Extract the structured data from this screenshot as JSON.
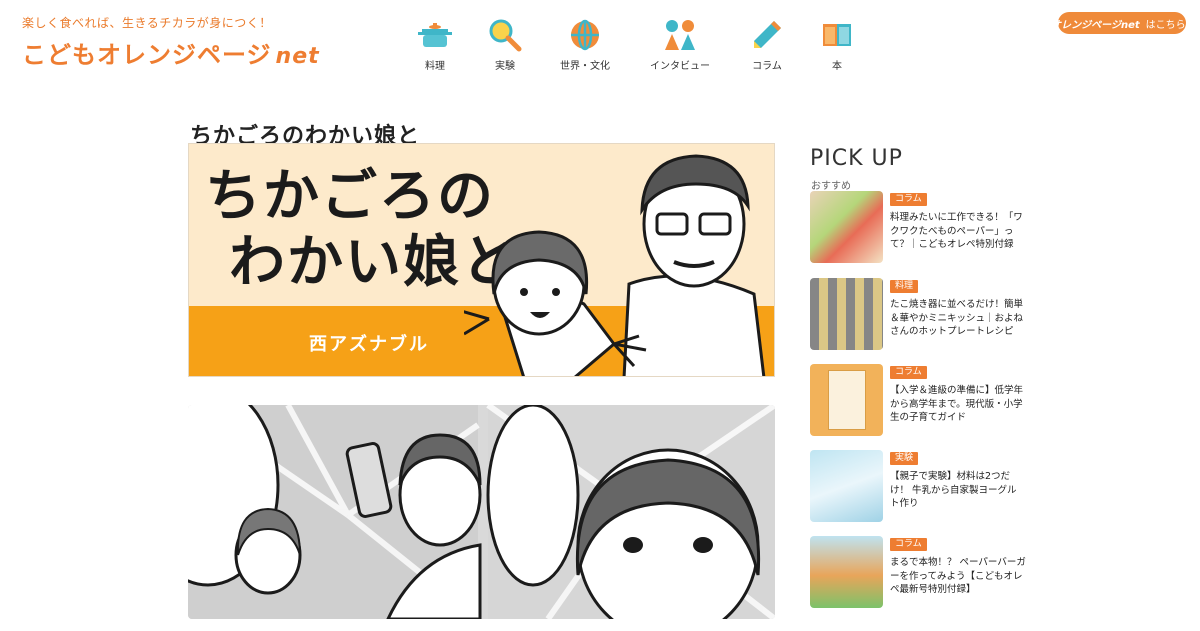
{
  "header": {
    "tagline": "楽しく食べれば、生きるチカラが身につく！",
    "logo_main": "こどもオレンジページ",
    "logo_suffix": "net",
    "nav": [
      {
        "label": "料理",
        "icon": "pot-icon"
      },
      {
        "label": "実験",
        "icon": "magnifier-icon"
      },
      {
        "label": "世界・文化",
        "icon": "globe-icon"
      },
      {
        "label": "インタビュー",
        "icon": "people-icon"
      },
      {
        "label": "コラム",
        "icon": "pencil-icon"
      },
      {
        "label": "本",
        "icon": "book-icon"
      }
    ],
    "ext_link": {
      "brand": "オレンジページnet",
      "suffix": "はこちら ›"
    }
  },
  "main": {
    "title": "ちかごろのわかい娘と",
    "banner": {
      "title_line1": "ちかごろの",
      "title_line2": "わかい娘と",
      "author": "西アズナブル"
    }
  },
  "sidebar": {
    "title": "PICK UP",
    "subtitle": "おすすめ",
    "items": [
      {
        "category": "コラム",
        "text": "料理みたいに工作できる！「ワクワクたべものペーパー」って？｜こどもオレペ特別付録"
      },
      {
        "category": "料理",
        "text": "たこ焼き器に並べるだけ！簡単＆華やかミニキッシュ｜およねさんのホットプレートレシピ"
      },
      {
        "category": "コラム",
        "text": "【入学＆進級の準備に】低学年から高学年まで。現代版・小学生の子育てガイド"
      },
      {
        "category": "実験",
        "text": "【親子で実験】材料は2つだけ！ 牛乳から自家製ヨーグルト作り"
      },
      {
        "category": "コラム",
        "text": "まるで本物！？ ペーパーバーガーを作ってみよう【こどもオレペ最新号特別付録】"
      }
    ]
  },
  "colors": {
    "brand_orange": "#ee7d31",
    "banner_bg": "#fdeacb",
    "banner_strip": "#f6a117"
  }
}
